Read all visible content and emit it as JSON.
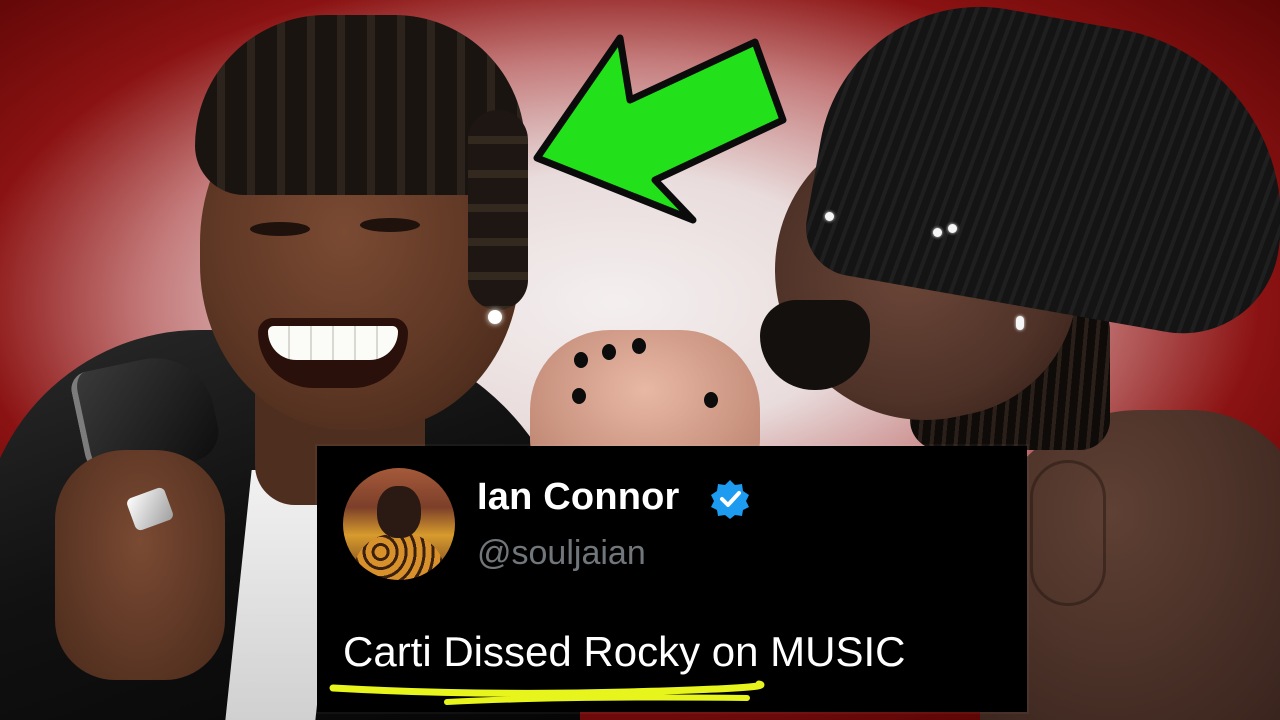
{
  "tweet": {
    "name": "Ian Connor",
    "handle": "@souljaian",
    "text": "Carti Dissed Rocky on MUSIC",
    "verified_icon": "verified-badge-icon",
    "verified_color": "#1d9bf0",
    "highlight_color": "#e8f51c"
  },
  "arrow": {
    "icon": "green-arrow-icon",
    "color": "#22e01a"
  },
  "colors": {
    "background_edge": "#7a0a0a",
    "tweet_background": "#000000",
    "tweet_handle": "#71767b"
  }
}
